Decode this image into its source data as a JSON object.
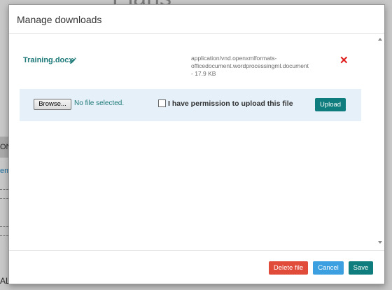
{
  "background": {
    "heading": "Plans",
    "fragments": [
      "ON",
      "eme",
      "AL"
    ]
  },
  "modal": {
    "title": "Manage downloads",
    "file": {
      "name": "Training.docx",
      "mime_line1": "application/vnd.openxmlformats-",
      "mime_line2": "officedocument.wordprocessingml.document",
      "size_line": "- 17.9 KB",
      "icons": {
        "edit": "pencil-icon",
        "delete": "delete-x-icon"
      }
    },
    "upload": {
      "browse_label": "Browse...",
      "no_file_text": "No file selected.",
      "permission_label": "I have permission to upload this file",
      "upload_label": "Upload"
    },
    "footer": {
      "delete_label": "Delete file",
      "cancel_label": "Cancel",
      "save_label": "Save"
    }
  },
  "colors": {
    "accent": "#0f7d7d",
    "danger": "#e04b3a",
    "cancel": "#3b9fe0",
    "delete_icon": "#e01b1b",
    "upload_row_bg": "#e6f0f8"
  }
}
